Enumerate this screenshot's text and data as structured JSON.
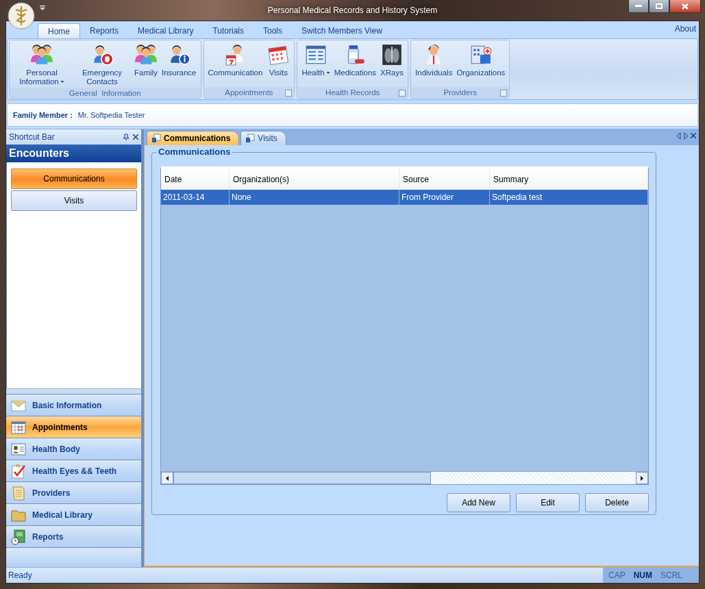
{
  "window": {
    "title": "Personal Medical Records and History System"
  },
  "ribbon_tabs": [
    {
      "label": "Home",
      "selected": true
    },
    {
      "label": "Reports",
      "selected": false
    },
    {
      "label": "Medical Library",
      "selected": false
    },
    {
      "label": "Tutorials",
      "selected": false
    },
    {
      "label": "Tools",
      "selected": false
    },
    {
      "label": "Switch Members View",
      "selected": false
    }
  ],
  "about": "About",
  "ribbon_groups": [
    {
      "title": "General  Information",
      "launcher": false,
      "buttons": [
        {
          "label": "Personal Information",
          "dropdown": true
        },
        {
          "label": "Emergency Contacts",
          "dropdown": false
        },
        {
          "label": "Family",
          "dropdown": false
        },
        {
          "label": "Insurance",
          "dropdown": false
        }
      ]
    },
    {
      "title": "Appointments",
      "launcher": true,
      "buttons": [
        {
          "label": "Communication",
          "dropdown": false
        },
        {
          "label": "Visits",
          "dropdown": false
        }
      ]
    },
    {
      "title": "Health Records",
      "launcher": true,
      "buttons": [
        {
          "label": "Health",
          "dropdown": true
        },
        {
          "label": "Medications",
          "dropdown": false
        },
        {
          "label": "XRays",
          "dropdown": false
        }
      ]
    },
    {
      "title": "Providers",
      "launcher": true,
      "buttons": [
        {
          "label": "Individuals",
          "dropdown": false
        },
        {
          "label": "Organizations",
          "dropdown": false
        }
      ]
    }
  ],
  "family_member": {
    "label": "Family Member :",
    "value": "Mr. Softpedia Tester"
  },
  "shortcut_bar": {
    "title": "Shortcut Bar",
    "section": "Encounters",
    "items": [
      {
        "label": "Communications",
        "selected": true
      },
      {
        "label": "Visits",
        "selected": false
      }
    ],
    "nav": [
      {
        "label": "Basic Information",
        "selected": false
      },
      {
        "label": "Appointments",
        "selected": true
      },
      {
        "label": "Health Body",
        "selected": false
      },
      {
        "label": "Health Eyes && Teeth",
        "selected": false
      },
      {
        "label": "Providers",
        "selected": false
      },
      {
        "label": "Medical Library",
        "selected": false
      },
      {
        "label": "Reports",
        "selected": false
      }
    ]
  },
  "doc_tabs": [
    {
      "label": "Communications",
      "selected": true
    },
    {
      "label": "Visits",
      "selected": false
    }
  ],
  "group_title": "Communications",
  "table": {
    "columns": [
      "Date",
      "Organization(s)",
      "Source",
      "Summary"
    ],
    "rows": [
      {
        "cells": [
          "2011-03-14",
          "None",
          "From Provider",
          "Softpedia test"
        ],
        "selected": true
      }
    ]
  },
  "buttons": [
    "Add New",
    "Edit",
    "Delete"
  ],
  "status_bar": {
    "text": "Ready",
    "indicators": [
      {
        "label": "CAP",
        "on": false
      },
      {
        "label": "NUM",
        "on": true
      },
      {
        "label": "SCRL",
        "on": false
      }
    ]
  }
}
